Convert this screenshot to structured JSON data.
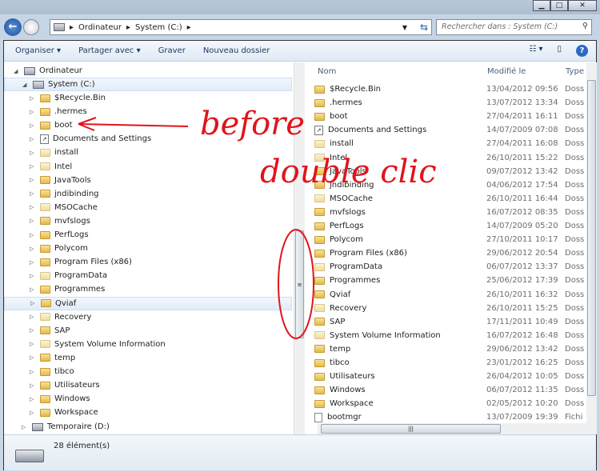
{
  "window": {
    "buttons": [
      "minimize",
      "maximize",
      "close"
    ]
  },
  "address": {
    "crumbs": [
      "Ordinateur",
      "System (C:)"
    ],
    "search_placeholder": "Rechercher dans : System (C:)"
  },
  "toolbar": {
    "organize": "Organiser ▾",
    "share": "Partager avec ▾",
    "burn": "Graver",
    "new_folder": "Nouveau dossier"
  },
  "tree": {
    "computer": "Ordinateur",
    "drive": "System (C:)",
    "items": [
      "$Recycle.Bin",
      ".hermes",
      "boot",
      "Documents and Settings",
      "install",
      "Intel",
      "JavaTools",
      "jndibinding",
      "MSOCache",
      "mvfslogs",
      "PerfLogs",
      "Polycom",
      "Program Files (x86)",
      "ProgramData",
      "Programmes",
      "Qviaf",
      "Recovery",
      "SAP",
      "System Volume Information",
      "temp",
      "tibco",
      "Utilisateurs",
      "Windows",
      "Workspace"
    ],
    "selected": "Qviaf",
    "drive2": "Temporaire (D:)"
  },
  "list": {
    "columns": [
      "Nom",
      "Modifié le",
      "Type"
    ],
    "rows": [
      {
        "name": "$Recycle.Bin",
        "date": "13/04/2012 09:56",
        "type": "Dossi"
      },
      {
        "name": ".hermes",
        "date": "13/07/2012 13:34",
        "type": "Dossi"
      },
      {
        "name": "boot",
        "date": "27/04/2011 16:11",
        "type": "Dossi"
      },
      {
        "name": "Documents and Settings",
        "date": "14/07/2009 07:08",
        "type": "Dossi"
      },
      {
        "name": "install",
        "date": "27/04/2011 16:08",
        "type": "Dossi"
      },
      {
        "name": "Intel",
        "date": "26/10/2011 15:22",
        "type": "Dossi"
      },
      {
        "name": "JavaTools",
        "date": "09/07/2012 13:42",
        "type": "Dossi"
      },
      {
        "name": "jndibinding",
        "date": "04/06/2012 17:54",
        "type": "Dossi"
      },
      {
        "name": "MSOCache",
        "date": "26/10/2011 16:44",
        "type": "Dossi"
      },
      {
        "name": "mvfslogs",
        "date": "16/07/2012 08:35",
        "type": "Dossi"
      },
      {
        "name": "PerfLogs",
        "date": "14/07/2009 05:20",
        "type": "Dossi"
      },
      {
        "name": "Polycom",
        "date": "27/10/2011 10:17",
        "type": "Dossi"
      },
      {
        "name": "Program Files (x86)",
        "date": "29/06/2012 20:54",
        "type": "Dossi"
      },
      {
        "name": "ProgramData",
        "date": "06/07/2012 13:37",
        "type": "Dossi"
      },
      {
        "name": "Programmes",
        "date": "25/06/2012 17:39",
        "type": "Dossi"
      },
      {
        "name": "Qviaf",
        "date": "26/10/2011 16:32",
        "type": "Dossi"
      },
      {
        "name": "Recovery",
        "date": "26/10/2011 15:25",
        "type": "Dossi"
      },
      {
        "name": "SAP",
        "date": "17/11/2011 10:49",
        "type": "Dossi"
      },
      {
        "name": "System Volume Information",
        "date": "16/07/2012 16:48",
        "type": "Dossi"
      },
      {
        "name": "temp",
        "date": "29/06/2012 13:42",
        "type": "Dossi"
      },
      {
        "name": "tibco",
        "date": "23/01/2012 16:25",
        "type": "Dossi"
      },
      {
        "name": "Utilisateurs",
        "date": "26/04/2012 10:05",
        "type": "Dossi"
      },
      {
        "name": "Windows",
        "date": "06/07/2012 11:35",
        "type": "Dossi"
      },
      {
        "name": "Workspace",
        "date": "02/05/2012 10:20",
        "type": "Dossi"
      },
      {
        "name": "bootmgr",
        "date": "13/07/2009 19:39",
        "type": "Fichi"
      }
    ]
  },
  "status": {
    "count": "28 élément(s)"
  },
  "annotation": {
    "line1": "before",
    "line2": "double clic",
    "color": "#e0141c"
  }
}
